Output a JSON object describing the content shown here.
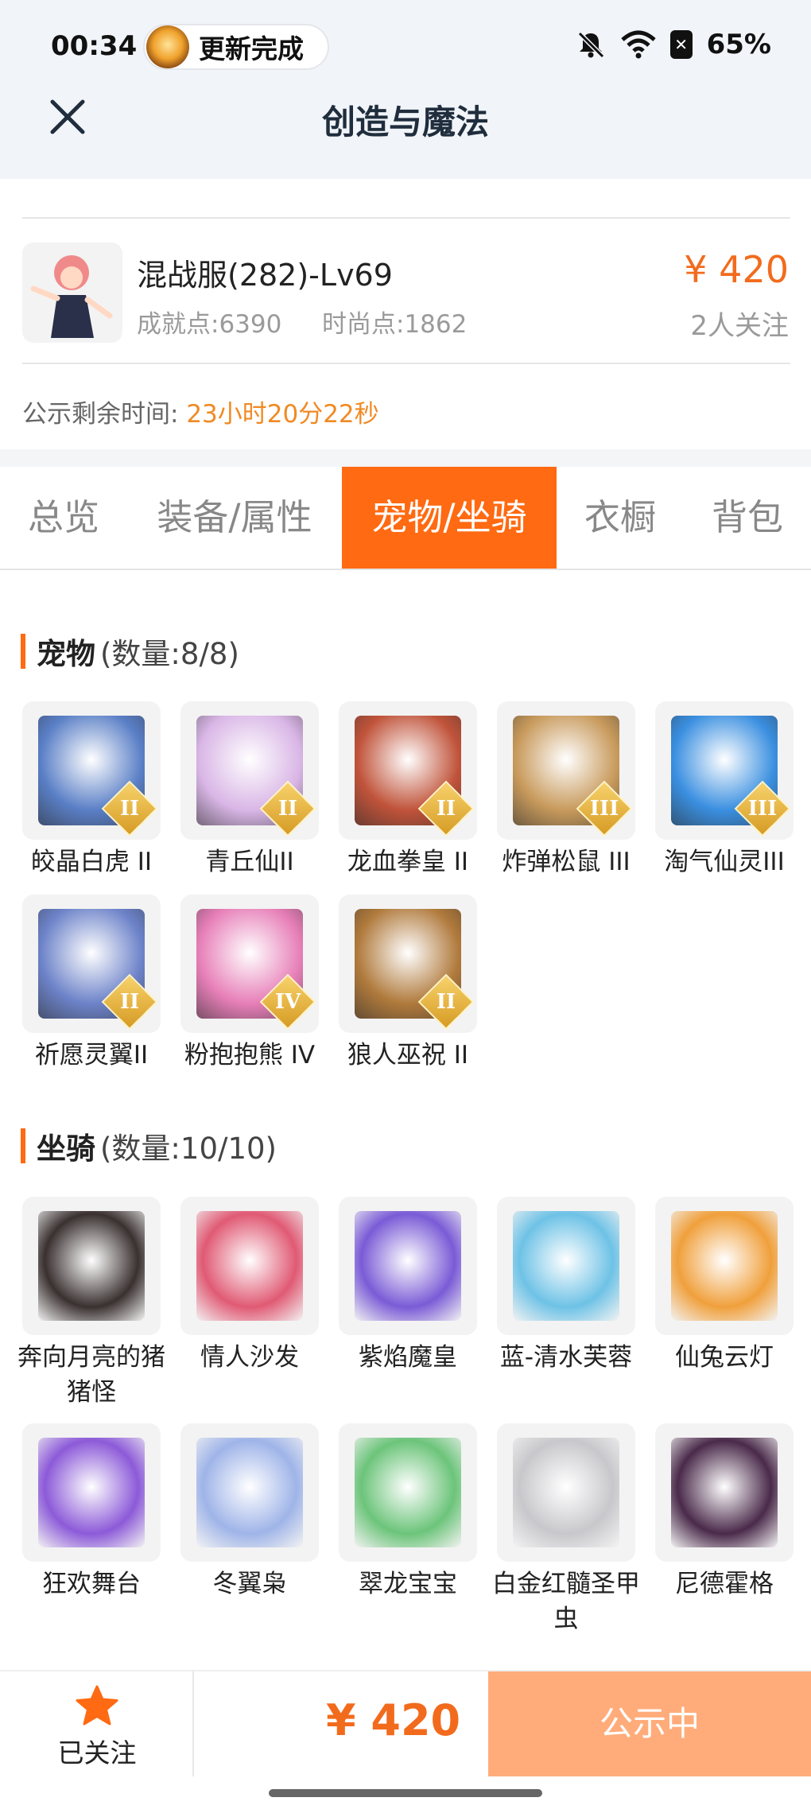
{
  "status_bar": {
    "time": "00:34",
    "notification": "更新完成",
    "battery": "65%"
  },
  "header": {
    "title": "创造与魔法"
  },
  "account": {
    "name": "混战服(282)-Lv69",
    "achievement": "成就点:6390",
    "fashion": "时尚点:1862",
    "price": "¥ 420",
    "followers": "2人关注",
    "remaining_label": "公示剩余时间:",
    "remaining_value": "23小时20分22秒"
  },
  "tabs": [
    {
      "label": "总览"
    },
    {
      "label": "装备/属性"
    },
    {
      "label": "宠物/坐骑"
    },
    {
      "label": "衣橱"
    },
    {
      "label": "背包"
    }
  ],
  "pets": {
    "title": "宠物",
    "count": "(数量:8/8)",
    "items": [
      {
        "name": "皎晶白虎 II",
        "grade": "II",
        "color": "#5a7fc6"
      },
      {
        "name": "青丘仙II",
        "grade": "II",
        "color": "#d9b6e6"
      },
      {
        "name": "龙血拳皇 II",
        "grade": "II",
        "color": "#c0533a"
      },
      {
        "name": "炸弹松鼠 III",
        "grade": "III",
        "color": "#c89a5c"
      },
      {
        "name": "淘气仙灵III",
        "grade": "III",
        "color": "#3a8fe0"
      },
      {
        "name": "祈愿灵翼II",
        "grade": "II",
        "color": "#6d83c9"
      },
      {
        "name": "粉抱抱熊 IV",
        "grade": "IV",
        "color": "#e77fb8"
      },
      {
        "name": "狼人巫祝 II",
        "grade": "II",
        "color": "#b07a3c"
      }
    ]
  },
  "mounts": {
    "title": "坐骑",
    "count": "(数量:10/10)",
    "items": [
      {
        "name": "奔向月亮的猪猪怪",
        "color": "#3a3030"
      },
      {
        "name": "情人沙发",
        "color": "#e05a74"
      },
      {
        "name": "紫焰魔皇",
        "color": "#7a5bd6"
      },
      {
        "name": "蓝-清水芙蓉",
        "color": "#6ec2e6"
      },
      {
        "name": "仙兔云灯",
        "color": "#f0a03c"
      },
      {
        "name": "狂欢舞台",
        "color": "#8c5ad8"
      },
      {
        "name": "冬翼枭",
        "color": "#9fb4e8"
      },
      {
        "name": "翠龙宝宝",
        "color": "#6cc47a"
      },
      {
        "name": "白金红髓圣甲虫",
        "color": "#c8c8cc"
      },
      {
        "name": "尼德霍格",
        "color": "#4a2a4a"
      }
    ]
  },
  "bottom": {
    "follow_label": "已关注",
    "price": "¥ 420",
    "status": "公示中"
  },
  "accent_color": "#ff6a12"
}
